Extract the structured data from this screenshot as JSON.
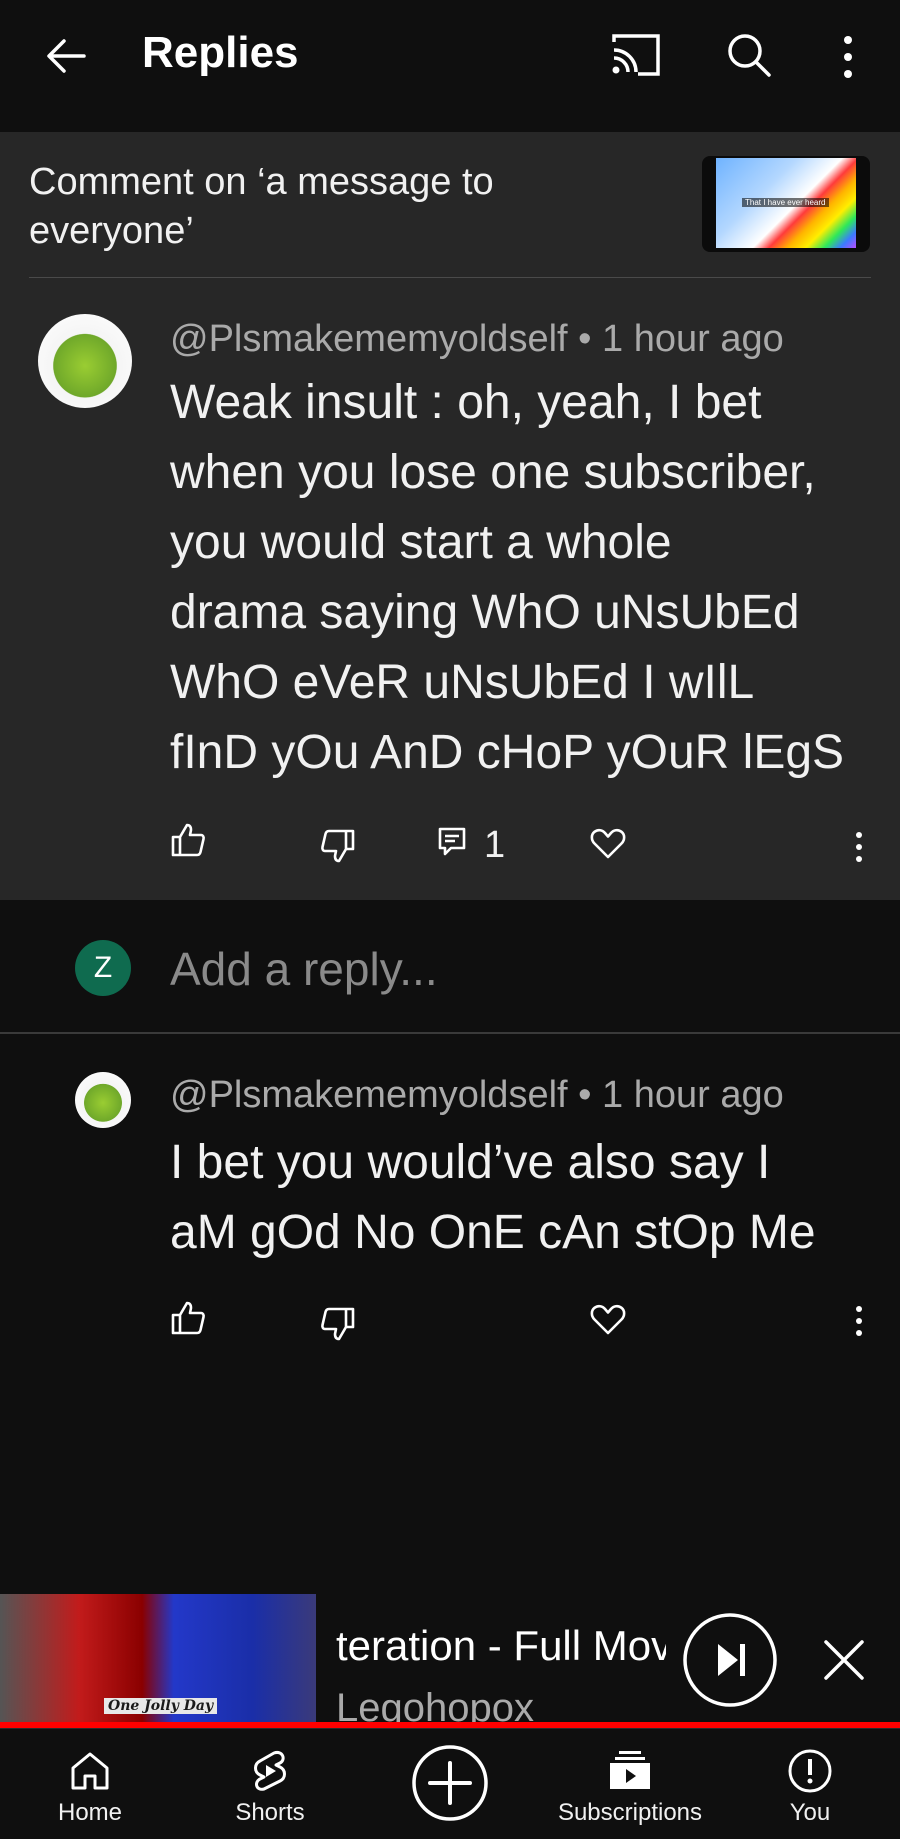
{
  "header": {
    "title": "Replies",
    "back_icon": "arrow-left-icon",
    "cast_icon": "cast-icon",
    "search_icon": "search-icon",
    "more_icon": "more-vertical-icon"
  },
  "context": {
    "text": "Comment on ‘a message to everyone’",
    "thumbnail_caption": "That I have ever heard"
  },
  "parent_comment": {
    "author": "@Plsmakememyoldself",
    "time": "1 hour ago",
    "separator": "•",
    "text_lines": [
      "Weak insult : oh, yeah, I bet",
      "when you lose one subscriber,",
      "you would start a whole",
      "drama saying WhO uNsUbEd",
      "WhO eVeR uNsUbEd I wIlL",
      "fInD yOu AnD cHoP yOuR lEgS"
    ],
    "reply_count": "1"
  },
  "reply_input": {
    "avatar_letter": "Z",
    "placeholder": "Add a reply..."
  },
  "replies": [
    {
      "author": "@Plsmakememyoldself",
      "time": "1 hour ago",
      "separator": "•",
      "text_lines": [
        "I bet you would’ve also say I",
        "aM gOd No OnE cAn stOp Me"
      ]
    }
  ],
  "miniplayer": {
    "title": "teration - Full Movi",
    "channel": "Legohopox",
    "art_caption": "One Jolly Day",
    "progress": 1.0
  },
  "nav": {
    "items": [
      {
        "label": "Home",
        "icon": "home-icon"
      },
      {
        "label": "Shorts",
        "icon": "shorts-icon"
      },
      {
        "label": "",
        "icon": "create-plus-icon"
      },
      {
        "label": "Subscriptions",
        "icon": "subscriptions-icon"
      },
      {
        "label": "You",
        "icon": "you-icon"
      }
    ]
  },
  "colors": {
    "background": "#0f0f0f",
    "parent_background": "#272727",
    "accent_red": "#ff0000",
    "reply_avatar": "#0f6b4f"
  }
}
